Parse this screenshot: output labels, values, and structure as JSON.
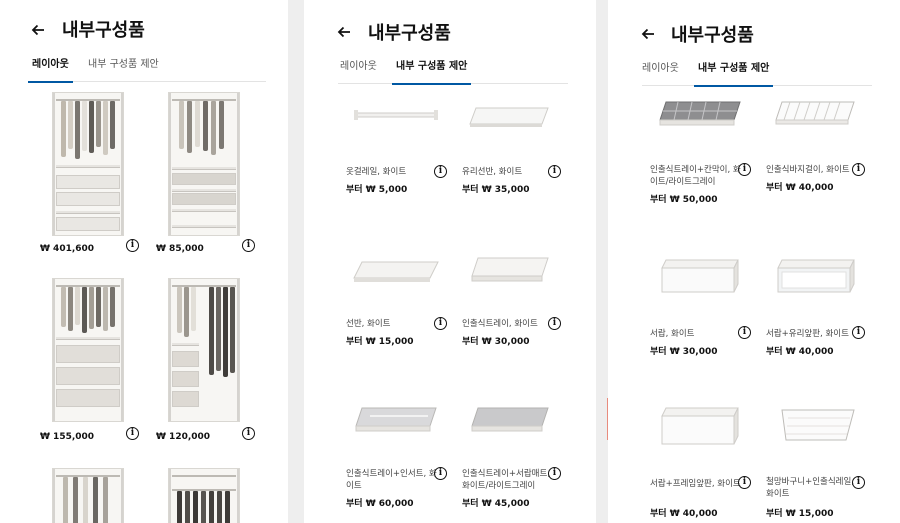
{
  "header": {
    "title": "내부구성품"
  },
  "tabs": {
    "layout": "레이아웃",
    "parts": "내부 구성품 제안"
  },
  "layouts": [
    {
      "price": "₩ 401,600"
    },
    {
      "price": "₩ 85,000"
    },
    {
      "price": "₩ 155,000"
    },
    {
      "price": "₩ 120,000"
    }
  ],
  "parts_col2": [
    {
      "name": "옷걸레일, 화이트",
      "price": "부터 ₩ 5,000"
    },
    {
      "name": "유리선반, 화이트",
      "price": "부터 ₩ 35,000"
    },
    {
      "name": "선반, 화이트",
      "price": "부터 ₩ 15,000"
    },
    {
      "name": "인출식트레이, 화이트",
      "price": "부터 ₩ 30,000"
    },
    {
      "name": "인출식트레이+인서트, 화이트",
      "price": "부터 ₩ 60,000"
    },
    {
      "name": "인출식트레이+서랍매트, 화이트/라이트그레이",
      "price": "부터 ₩ 45,000"
    }
  ],
  "parts_col3": [
    {
      "name": "인출식트레이+칸막이, 화이트/라이트그레이",
      "price": "부터 ₩ 50,000"
    },
    {
      "name": "인출식바지걸이, 화이트",
      "price": "부터 ₩ 40,000"
    },
    {
      "name": "서랍, 화이트",
      "price": "부터 ₩ 30,000"
    },
    {
      "name": "서랍+유리앞판, 화이트",
      "price": "부터 ₩ 40,000"
    },
    {
      "name": "서랍+프레임앞판, 화이트",
      "price": "부터 ₩ 40,000"
    },
    {
      "name": "철망바구니+인출식레일, 화이트",
      "price": "부터 ₩ 15,000"
    }
  ],
  "colors": {
    "accent": "#0058a3",
    "text": "#111111"
  },
  "icons": {
    "back": "arrow-left-icon",
    "info": "info-circle-icon"
  }
}
